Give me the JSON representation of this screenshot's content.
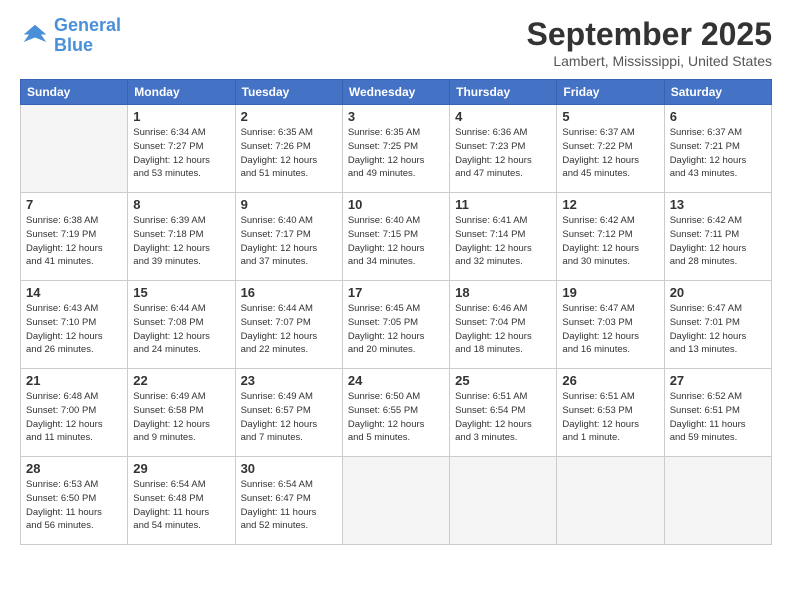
{
  "logo": {
    "line1": "General",
    "line2": "Blue"
  },
  "title": "September 2025",
  "location": "Lambert, Mississippi, United States",
  "days_header": [
    "Sunday",
    "Monday",
    "Tuesday",
    "Wednesday",
    "Thursday",
    "Friday",
    "Saturday"
  ],
  "weeks": [
    [
      {
        "day": "",
        "info": ""
      },
      {
        "day": "1",
        "info": "Sunrise: 6:34 AM\nSunset: 7:27 PM\nDaylight: 12 hours\nand 53 minutes."
      },
      {
        "day": "2",
        "info": "Sunrise: 6:35 AM\nSunset: 7:26 PM\nDaylight: 12 hours\nand 51 minutes."
      },
      {
        "day": "3",
        "info": "Sunrise: 6:35 AM\nSunset: 7:25 PM\nDaylight: 12 hours\nand 49 minutes."
      },
      {
        "day": "4",
        "info": "Sunrise: 6:36 AM\nSunset: 7:23 PM\nDaylight: 12 hours\nand 47 minutes."
      },
      {
        "day": "5",
        "info": "Sunrise: 6:37 AM\nSunset: 7:22 PM\nDaylight: 12 hours\nand 45 minutes."
      },
      {
        "day": "6",
        "info": "Sunrise: 6:37 AM\nSunset: 7:21 PM\nDaylight: 12 hours\nand 43 minutes."
      }
    ],
    [
      {
        "day": "7",
        "info": "Sunrise: 6:38 AM\nSunset: 7:19 PM\nDaylight: 12 hours\nand 41 minutes."
      },
      {
        "day": "8",
        "info": "Sunrise: 6:39 AM\nSunset: 7:18 PM\nDaylight: 12 hours\nand 39 minutes."
      },
      {
        "day": "9",
        "info": "Sunrise: 6:40 AM\nSunset: 7:17 PM\nDaylight: 12 hours\nand 37 minutes."
      },
      {
        "day": "10",
        "info": "Sunrise: 6:40 AM\nSunset: 7:15 PM\nDaylight: 12 hours\nand 34 minutes."
      },
      {
        "day": "11",
        "info": "Sunrise: 6:41 AM\nSunset: 7:14 PM\nDaylight: 12 hours\nand 32 minutes."
      },
      {
        "day": "12",
        "info": "Sunrise: 6:42 AM\nSunset: 7:12 PM\nDaylight: 12 hours\nand 30 minutes."
      },
      {
        "day": "13",
        "info": "Sunrise: 6:42 AM\nSunset: 7:11 PM\nDaylight: 12 hours\nand 28 minutes."
      }
    ],
    [
      {
        "day": "14",
        "info": "Sunrise: 6:43 AM\nSunset: 7:10 PM\nDaylight: 12 hours\nand 26 minutes."
      },
      {
        "day": "15",
        "info": "Sunrise: 6:44 AM\nSunset: 7:08 PM\nDaylight: 12 hours\nand 24 minutes."
      },
      {
        "day": "16",
        "info": "Sunrise: 6:44 AM\nSunset: 7:07 PM\nDaylight: 12 hours\nand 22 minutes."
      },
      {
        "day": "17",
        "info": "Sunrise: 6:45 AM\nSunset: 7:05 PM\nDaylight: 12 hours\nand 20 minutes."
      },
      {
        "day": "18",
        "info": "Sunrise: 6:46 AM\nSunset: 7:04 PM\nDaylight: 12 hours\nand 18 minutes."
      },
      {
        "day": "19",
        "info": "Sunrise: 6:47 AM\nSunset: 7:03 PM\nDaylight: 12 hours\nand 16 minutes."
      },
      {
        "day": "20",
        "info": "Sunrise: 6:47 AM\nSunset: 7:01 PM\nDaylight: 12 hours\nand 13 minutes."
      }
    ],
    [
      {
        "day": "21",
        "info": "Sunrise: 6:48 AM\nSunset: 7:00 PM\nDaylight: 12 hours\nand 11 minutes."
      },
      {
        "day": "22",
        "info": "Sunrise: 6:49 AM\nSunset: 6:58 PM\nDaylight: 12 hours\nand 9 minutes."
      },
      {
        "day": "23",
        "info": "Sunrise: 6:49 AM\nSunset: 6:57 PM\nDaylight: 12 hours\nand 7 minutes."
      },
      {
        "day": "24",
        "info": "Sunrise: 6:50 AM\nSunset: 6:55 PM\nDaylight: 12 hours\nand 5 minutes."
      },
      {
        "day": "25",
        "info": "Sunrise: 6:51 AM\nSunset: 6:54 PM\nDaylight: 12 hours\nand 3 minutes."
      },
      {
        "day": "26",
        "info": "Sunrise: 6:51 AM\nSunset: 6:53 PM\nDaylight: 12 hours\nand 1 minute."
      },
      {
        "day": "27",
        "info": "Sunrise: 6:52 AM\nSunset: 6:51 PM\nDaylight: 11 hours\nand 59 minutes."
      }
    ],
    [
      {
        "day": "28",
        "info": "Sunrise: 6:53 AM\nSunset: 6:50 PM\nDaylight: 11 hours\nand 56 minutes."
      },
      {
        "day": "29",
        "info": "Sunrise: 6:54 AM\nSunset: 6:48 PM\nDaylight: 11 hours\nand 54 minutes."
      },
      {
        "day": "30",
        "info": "Sunrise: 6:54 AM\nSunset: 6:47 PM\nDaylight: 11 hours\nand 52 minutes."
      },
      {
        "day": "",
        "info": ""
      },
      {
        "day": "",
        "info": ""
      },
      {
        "day": "",
        "info": ""
      },
      {
        "day": "",
        "info": ""
      }
    ]
  ]
}
